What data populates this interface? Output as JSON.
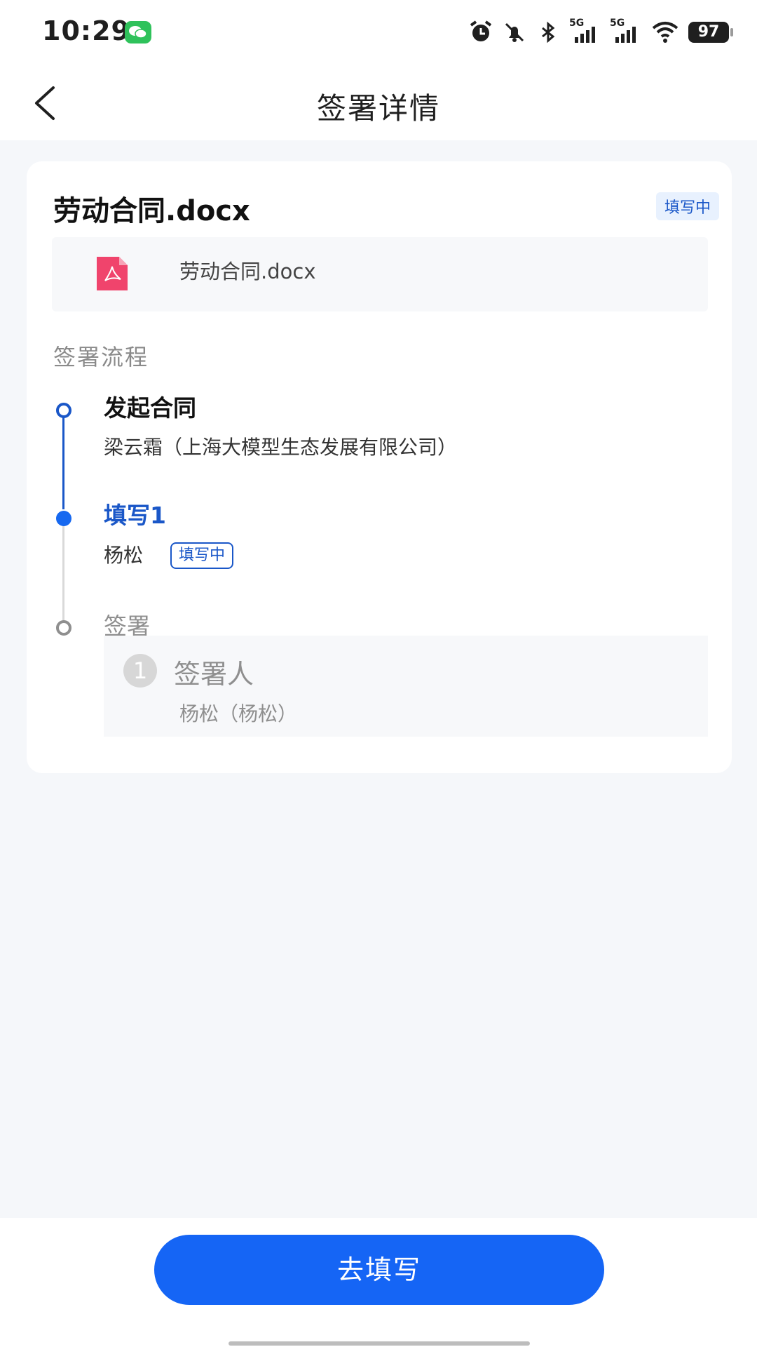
{
  "status_bar": {
    "time": "10:29",
    "signal1_label": "5G",
    "signal2_label": "5G",
    "battery": "97",
    "icons": [
      "wechat-icon",
      "alarm-icon",
      "mute-bell-icon",
      "bluetooth-icon",
      "signal-icon",
      "wifi-icon",
      "battery-icon"
    ]
  },
  "header": {
    "title": "签署详情",
    "back_icon": "chevron-left-icon"
  },
  "card": {
    "doc_title": "劳动合同.docx",
    "status_tag": "填写中",
    "file": {
      "name": "劳动合同.docx",
      "icon": "pdf-file-icon",
      "icon_color": "#f0446c"
    },
    "section_label": "签署流程",
    "timeline": [
      {
        "title": "发起合同",
        "subtitle": "梁云霜（上海大模型生态发展有限公司）",
        "state": "done"
      },
      {
        "title": "填写1",
        "subtitle": "杨松",
        "badge": "填写中",
        "state": "current"
      },
      {
        "title": "签署",
        "state": "pending",
        "signer": {
          "number": "1",
          "label": "签署人",
          "name": "杨松（杨松）"
        }
      }
    ]
  },
  "action_button": {
    "label": "去填写"
  },
  "colors": {
    "primary": "#1565f5",
    "tag_bg": "#e8f1fe",
    "tag_text": "#1a57c8",
    "page_bg": "#f5f7fa"
  }
}
